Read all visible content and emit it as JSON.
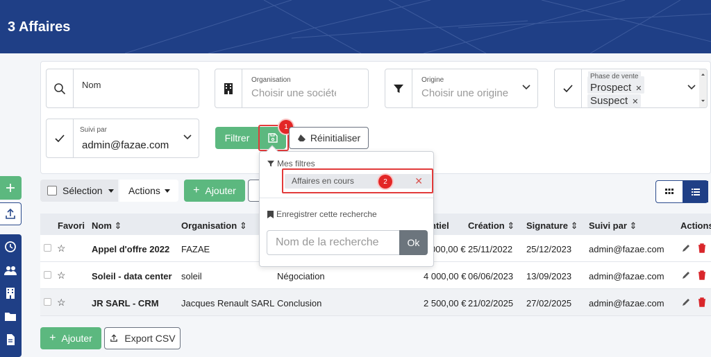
{
  "header": {
    "title": "3 Affaires"
  },
  "filters": {
    "nom": {
      "label": "Nom"
    },
    "organisation": {
      "label": "Organisation",
      "placeholder": "Choisir une société"
    },
    "origine": {
      "label": "Origine",
      "placeholder": "Choisir une origine"
    },
    "phase": {
      "label": "Phase de vente",
      "tags": [
        "Prospect",
        "Suspect"
      ]
    },
    "suivi": {
      "label": "Suivi par",
      "value": "admin@fazae.com"
    },
    "filtrer_label": "Filtrer",
    "reset_label": "Réinitialiser"
  },
  "annotations": {
    "badge1": "1",
    "badge2": "2"
  },
  "popup": {
    "mes_filtres": "Mes filtres",
    "saved_item": "Affaires en cours",
    "save_search": "Enregistrer cette recherche",
    "name_placeholder": "Nom de la recherche",
    "ok_label": "Ok"
  },
  "toolbar": {
    "selection_label": "Sélection",
    "actions_label": "Actions",
    "ajouter_label": "Ajouter"
  },
  "table": {
    "headers": {
      "favori": "Favori",
      "nom": "Nom",
      "organisation": "Organisation",
      "potentiel": "ntiel",
      "creation": "Création",
      "signature": "Signature",
      "suivi": "Suivi par",
      "actions": "Actions"
    },
    "rows": [
      {
        "nom": "Appel d'offre 2022",
        "organisation": "FAZAE",
        "phase": "",
        "potentiel": "000,00 €",
        "creation": "25/11/2022",
        "signature": "25/12/2023",
        "suivi": "admin@fazae.com"
      },
      {
        "nom": "Soleil - data center",
        "organisation": "soleil",
        "phase": "Négociation",
        "potentiel": "4 000,00 €",
        "creation": "06/06/2023",
        "signature": "13/09/2023",
        "suivi": "admin@fazae.com"
      },
      {
        "nom": "JR SARL - CRM",
        "organisation": "Jacques Renault SARL",
        "phase": "Conclusion",
        "potentiel": "2 500,00 €",
        "creation": "21/02/2025",
        "signature": "27/02/2025",
        "suivi": "admin@fazae.com"
      }
    ]
  },
  "footer": {
    "ajouter_label": "Ajouter",
    "export_label": "Export CSV"
  },
  "colors": {
    "navy": "#1f3f86",
    "green": "#5cb87f",
    "red": "#e23a3a"
  }
}
